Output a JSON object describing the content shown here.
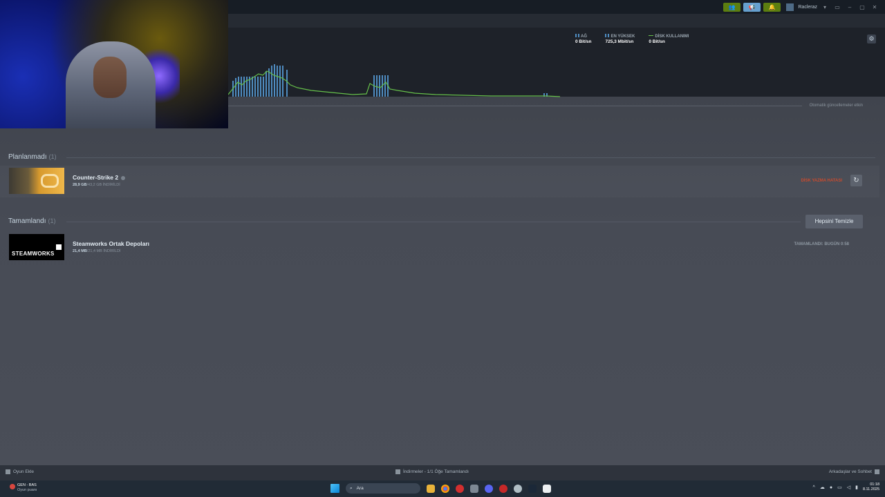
{
  "titlebar": {
    "user_name": "Racleraz",
    "buttons": [
      "friends-icon",
      "megaphone-icon",
      "bell-icon"
    ],
    "window_controls": [
      "monitor-icon",
      "minimize-icon",
      "maximize-icon",
      "close-icon"
    ]
  },
  "graph": {
    "stats": [
      {
        "label": "AĞ",
        "value": "0 Bit/sn"
      },
      {
        "label": "EN YÜKSEK",
        "value": "725,3 Mbit/sn"
      },
      {
        "label": "DİSK KULLANIMI",
        "value": "0 Bit/sn"
      }
    ],
    "auto_updates": "Otomatik güncellemeler etkin"
  },
  "sections": {
    "unscheduled": {
      "title": "Planlanmadı",
      "count": "(1)",
      "item": {
        "name": "Counter-Strike 2",
        "downloaded": "28,9 GB",
        "total": "/43,2 GB İNDİRİLDİ",
        "status": "DİSK YAZMA HATASI"
      }
    },
    "completed": {
      "title": "Tamamlandı",
      "count": "(1)",
      "clear_all": "Hepsini Temizle",
      "item": {
        "name": "Steamworks Ortak Depoları",
        "thumb_text": "STEAMWORKS",
        "downloaded": "21,4 MB",
        "total": "/21,4 MB İNDİRİLDİ",
        "status": "TAMAMLANDI: BUGÜN 0:58"
      }
    }
  },
  "bottom_bar": {
    "add_game": "Oyun Ekle",
    "downloads": "İndirmeler - 1/1 Öğe Tamamlandı",
    "friends_chat": "Arkadaşlar ve Sohbet"
  },
  "taskbar": {
    "news_line1": "GEN - BAS",
    "news_line2": "Oyun puanı",
    "search_placeholder": "Ara",
    "time": "01:18",
    "date": "8.11.2025"
  },
  "colors": {
    "error": "#c94b2e",
    "graph_bars": "#4f8cc0",
    "graph_line": "#66c04a"
  }
}
